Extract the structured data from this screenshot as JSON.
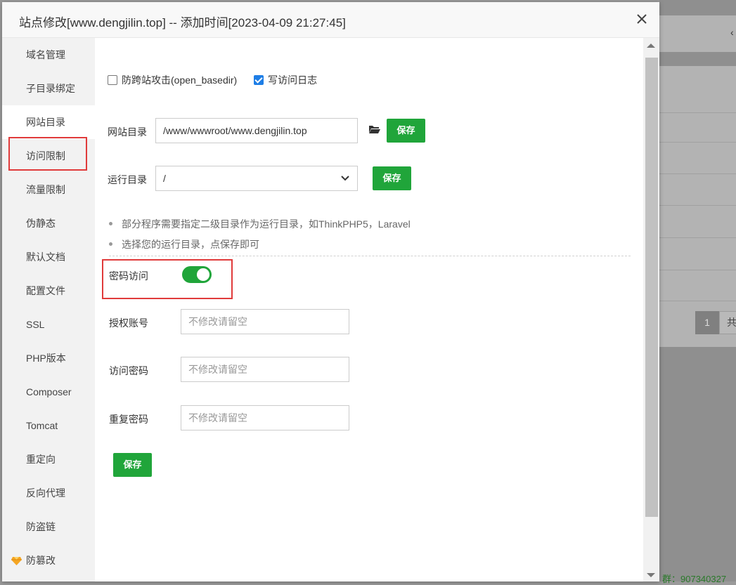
{
  "dialog": {
    "title": "站点修改[www.dengjilin.top] -- 添加时间[2023-04-09 21:27:45]"
  },
  "sidebar": {
    "items": [
      {
        "label": "域名管理"
      },
      {
        "label": "子目录绑定"
      },
      {
        "label": "网站目录",
        "active": true
      },
      {
        "label": "访问限制"
      },
      {
        "label": "流量限制"
      },
      {
        "label": "伪静态"
      },
      {
        "label": "默认文档"
      },
      {
        "label": "配置文件"
      },
      {
        "label": "SSL"
      },
      {
        "label": "PHP版本"
      },
      {
        "label": "Composer"
      },
      {
        "label": "Tomcat"
      },
      {
        "label": "重定向"
      },
      {
        "label": "反向代理"
      },
      {
        "label": "防盗链"
      },
      {
        "label": "防篡改",
        "icon": "diamond-icon"
      }
    ]
  },
  "options": {
    "anti_xss_label": "防跨站攻击(open_basedir)",
    "anti_xss_checked": false,
    "access_log_label": "写访问日志",
    "access_log_checked": true
  },
  "site_dir": {
    "label": "网站目录",
    "value": "/www/wwwroot/www.dengjilin.top",
    "save_label": "保存"
  },
  "run_dir": {
    "label": "运行目录",
    "value": "/",
    "save_label": "保存"
  },
  "tips": [
    "部分程序需要指定二级目录作为运行目录，如ThinkPHP5，Laravel",
    "选择您的运行目录，点保存即可"
  ],
  "password_access": {
    "label": "密码访问",
    "enabled": true,
    "account_label": "授权账号",
    "account_placeholder": "不修改请留空",
    "password_label": "访问密码",
    "password_placeholder": "不修改请留空",
    "repeat_label": "重复密码",
    "repeat_placeholder": "不修改请留空",
    "save_label": "保存"
  },
  "background": {
    "pager_current": "1",
    "pager_total_prefix": "共",
    "footer_text": "群：907340327"
  },
  "colors": {
    "accent_green": "#20a53a",
    "highlight_red": "#e03b3b",
    "checkbox_blue": "#1e7ee6"
  }
}
